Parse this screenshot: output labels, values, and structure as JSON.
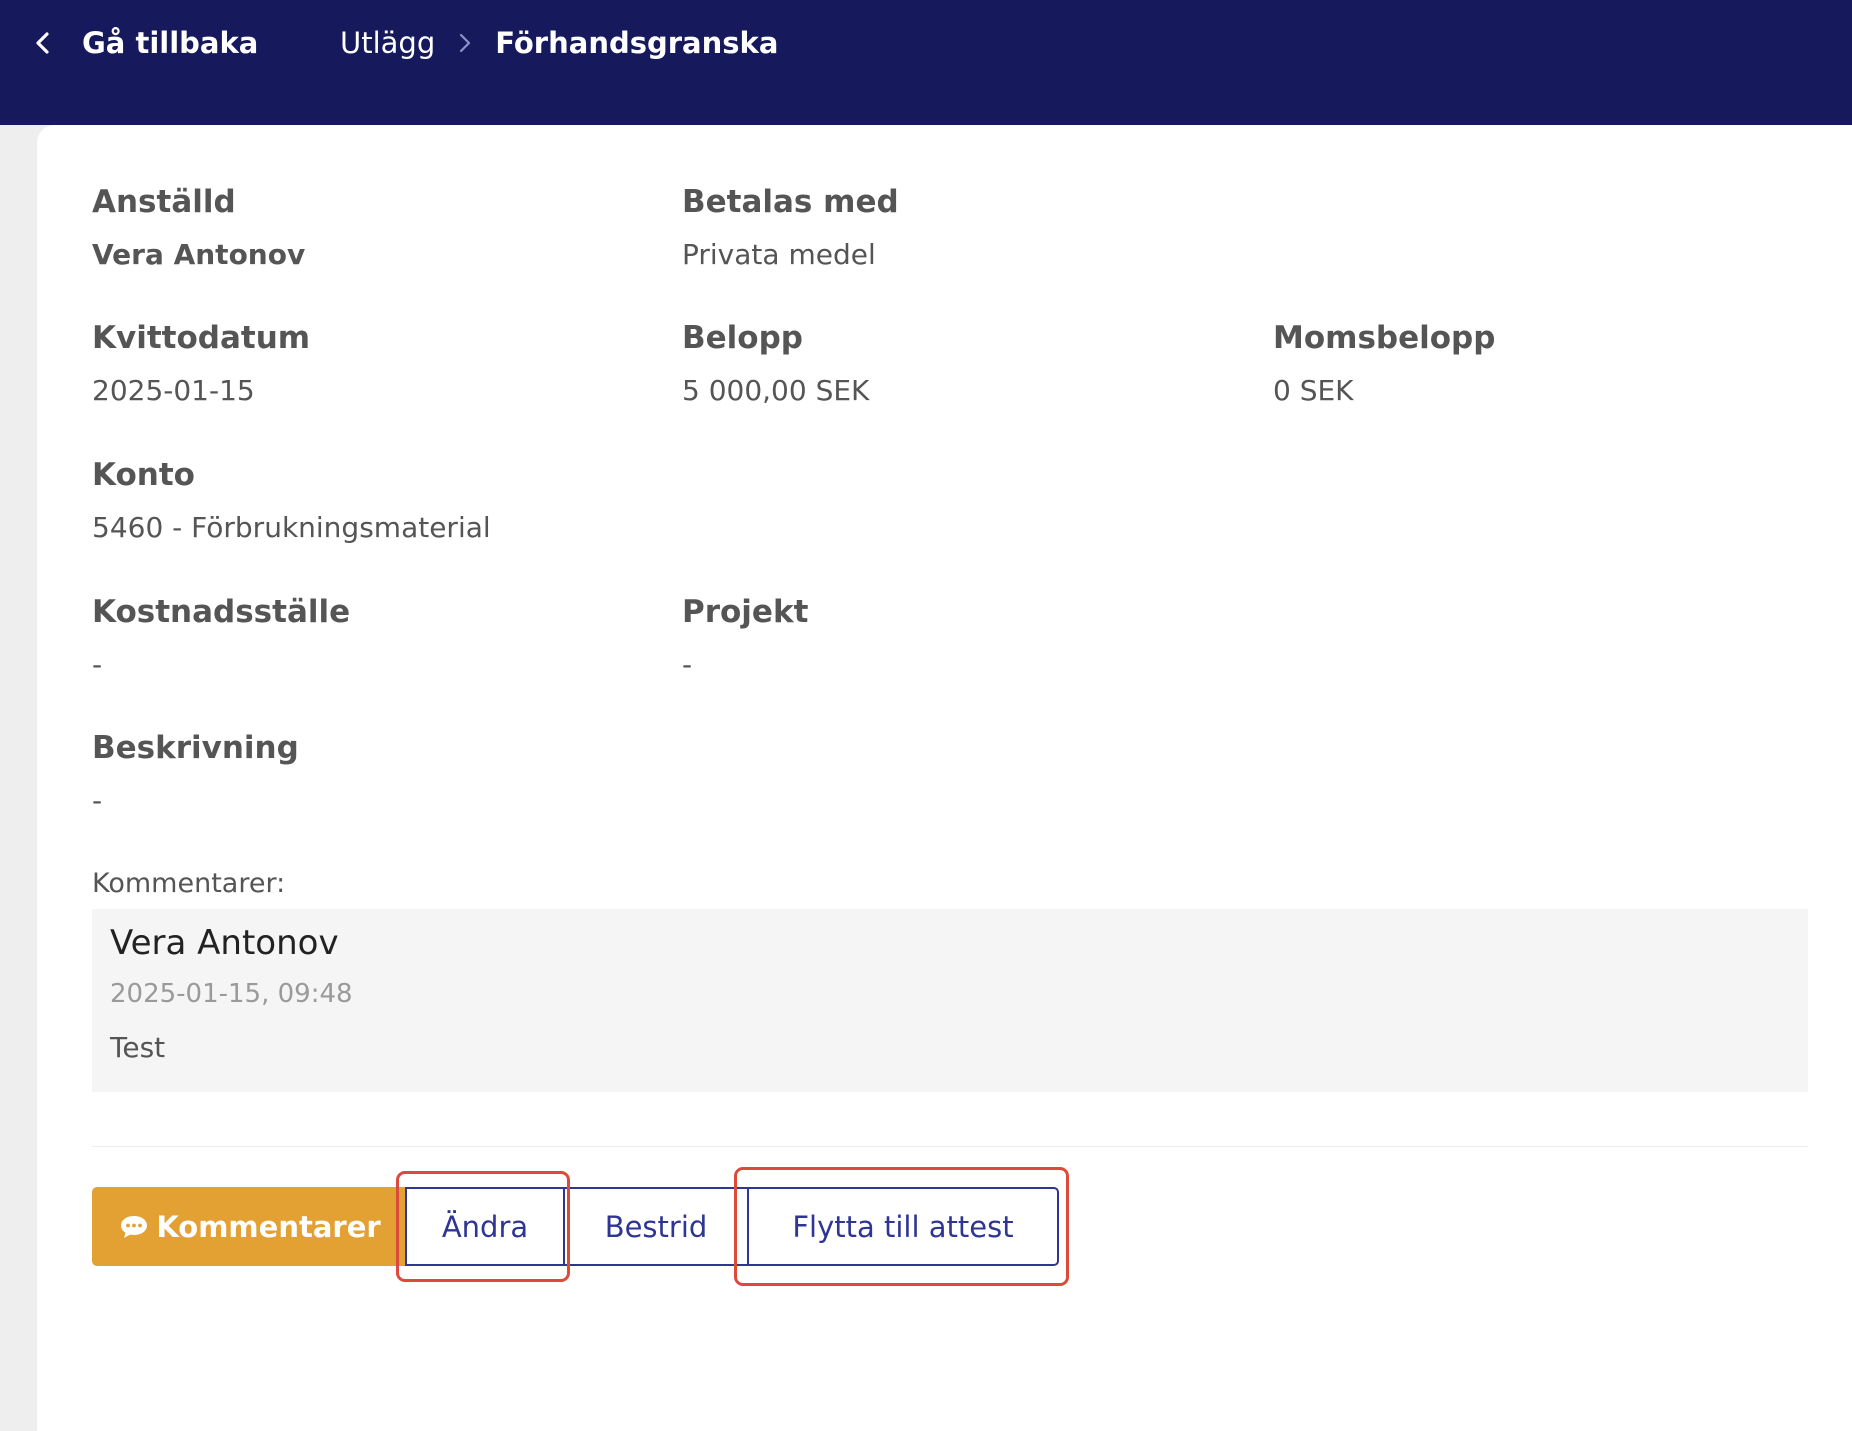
{
  "header": {
    "back_label": "Gå tillbaka",
    "breadcrumb_parent": "Utlägg",
    "breadcrumb_current": "Förhandsgranska"
  },
  "fields": {
    "employee": {
      "label": "Anställd",
      "value": "Vera Antonov"
    },
    "paid_with": {
      "label": "Betalas med",
      "value": "Privata medel"
    },
    "receipt_date": {
      "label": "Kvittodatum",
      "value": "2025-01-15"
    },
    "amount": {
      "label": "Belopp",
      "value": "5 000,00 SEK"
    },
    "vat_amount": {
      "label": "Momsbelopp",
      "value": "0 SEK"
    },
    "account": {
      "label": "Konto",
      "value": "5460 - Förbrukningsmaterial"
    },
    "cost_center": {
      "label": "Kostnadsställe",
      "value": "-"
    },
    "project": {
      "label": "Projekt",
      "value": "-"
    },
    "description": {
      "label": "Beskrivning",
      "value": "-"
    }
  },
  "comments": {
    "title": "Kommentarer:",
    "items": [
      {
        "author": "Vera Antonov",
        "timestamp": "2025-01-15, 09:48",
        "text": "Test"
      }
    ]
  },
  "actions": {
    "comments_label": "Kommentarer",
    "edit_label": "Ändra",
    "dispute_label": "Bestrid",
    "move_label": "Flytta till attest"
  },
  "colors": {
    "header_bg": "#16195c",
    "accent_orange": "#e3a033",
    "button_blue": "#2e3592",
    "highlight_red": "#de4a3a"
  }
}
